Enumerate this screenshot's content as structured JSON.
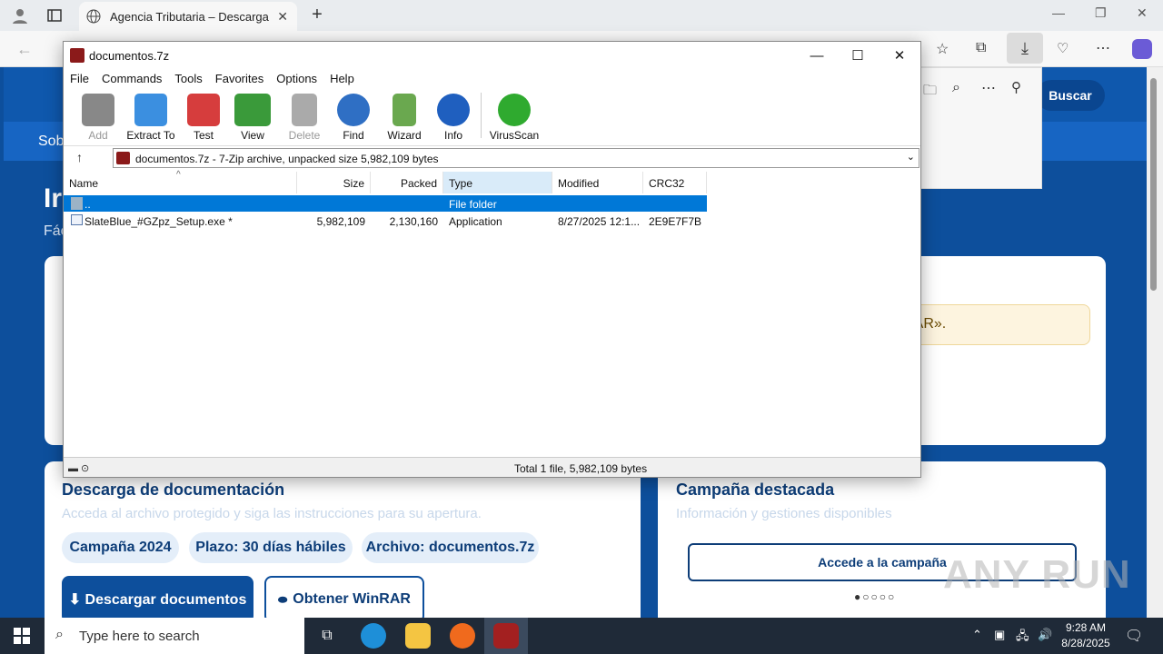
{
  "browser": {
    "tab_title": "Agencia Tributaria – Descarga de",
    "search_button": "Buscar"
  },
  "page": {
    "nav_text": "Sob",
    "hero_title": "Ir",
    "hero_subtitle": "Fác",
    "notice_text": "ner WinRAR».",
    "card_download": {
      "title": "Descarga de documentación",
      "subtitle": "Acceda al archivo protegido y siga las instrucciones para su apertura.",
      "pills": [
        "Campaña 2024",
        "Plazo: 30 días hábiles",
        "Archivo: documentos.7z"
      ],
      "download_button": "⬇ Descargar documentos",
      "winrar_button": "Obtener WinRAR"
    },
    "card_campaign": {
      "title": "Campaña destacada",
      "subtitle": "Información y gestiones disponibles",
      "button": "Accede a la campaña",
      "dots": "●○○○○"
    },
    "watermark": "ANY RUN"
  },
  "archive_window": {
    "title": "documentos.7z",
    "menu": [
      "File",
      "Commands",
      "Tools",
      "Favorites",
      "Options",
      "Help"
    ],
    "toolbar": [
      {
        "label": "Add",
        "icon": "add-icon",
        "enabled": false
      },
      {
        "label": "Extract To",
        "icon": "extract-icon",
        "enabled": true
      },
      {
        "label": "Test",
        "icon": "test-icon",
        "enabled": true
      },
      {
        "label": "View",
        "icon": "view-icon",
        "enabled": true
      },
      {
        "label": "Delete",
        "icon": "delete-icon",
        "enabled": false
      },
      {
        "label": "Find",
        "icon": "find-icon",
        "enabled": true
      },
      {
        "label": "Wizard",
        "icon": "wizard-icon",
        "enabled": true
      },
      {
        "label": "Info",
        "icon": "info-icon",
        "enabled": true
      },
      {
        "label": "VirusScan",
        "icon": "virusscan-icon",
        "enabled": true
      }
    ],
    "path": "documentos.7z - 7-Zip archive, unpacked size 5,982,109 bytes",
    "columns": [
      "Name",
      "Size",
      "Packed",
      "Type",
      "Modified",
      "CRC32"
    ],
    "rows": [
      {
        "name": "..",
        "size": "",
        "packed": "",
        "type": "File folder",
        "modified": "",
        "crc": ""
      },
      {
        "name": "SlateBlue_#GZpz_Setup.exe *",
        "size": "5,982,109",
        "packed": "2,130,160",
        "type": "Application",
        "modified": "8/27/2025 12:1...",
        "crc": "2E9E7F7B"
      }
    ],
    "status": "Total 1 file, 5,982,109 bytes"
  },
  "taskbar": {
    "search_placeholder": "Type here to search",
    "time": "9:28 AM",
    "date": "8/28/2025"
  },
  "colors": {
    "accent": "#0d4f9c",
    "selection": "#0078d7"
  }
}
